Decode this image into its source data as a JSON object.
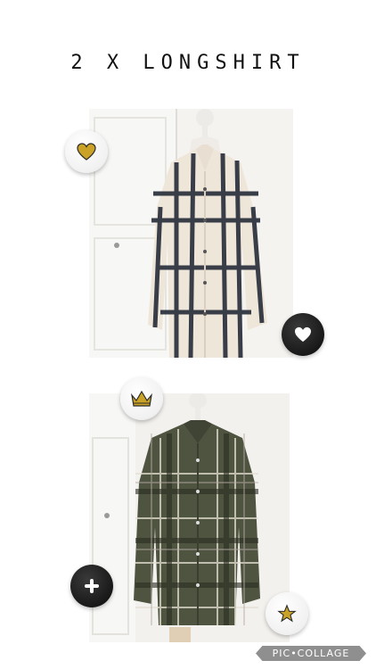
{
  "title": "2 X LONGSHIRT",
  "photos": [
    {
      "name": "checked-shirt-cream"
    },
    {
      "name": "checked-shirt-olive"
    }
  ],
  "stickers": {
    "gold_heart": "heart-icon",
    "black_heart": "heart-icon",
    "crown": "crown-icon",
    "plus": "plus-icon",
    "star": "star-icon"
  },
  "watermark": "PIC•COLLAGE",
  "colors": {
    "gold": "#c9a227",
    "cream_shirt": "#efe6da",
    "olive_shirt": "#4e5440",
    "plaid_dark": "#1f2633"
  }
}
